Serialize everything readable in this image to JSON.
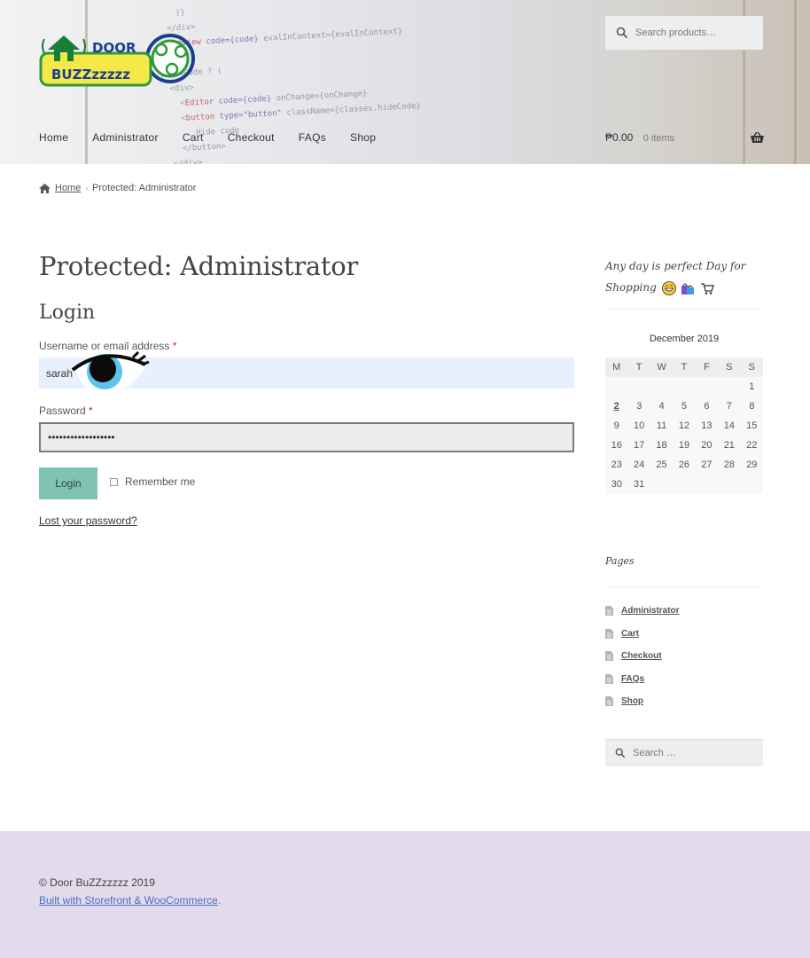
{
  "header": {
    "logo_text_top": "DOOR",
    "logo_text_bottom": "BUZZzzzzz",
    "search_placeholder": "Search products…",
    "nav": [
      "Home",
      "Administrator",
      "Cart",
      "Checkout",
      "FAQs",
      "Shop"
    ],
    "cart_amount": "₱0.00",
    "cart_count": "0 items"
  },
  "breadcrumb": {
    "home": "Home",
    "current": "Protected: Administrator"
  },
  "main": {
    "page_title": "Protected: Administrator",
    "login_heading": "Login",
    "username_label": "Username or email address",
    "username_value": "sarah",
    "password_label": "Password",
    "password_value": "••••••••••••••••••",
    "required_mark": "*",
    "login_button": "Login",
    "remember_label": "Remember me",
    "lost_password": "Lost your password?"
  },
  "sidebar": {
    "tagline": "Any day is perfect Day for Shopping",
    "calendar": {
      "caption": "December 2019",
      "weekdays": [
        "M",
        "T",
        "W",
        "T",
        "F",
        "S",
        "S"
      ],
      "weeks": [
        [
          "",
          "",
          "",
          "",
          "",
          "",
          "1"
        ],
        [
          "2",
          "3",
          "4",
          "5",
          "6",
          "7",
          "8"
        ],
        [
          "9",
          "10",
          "11",
          "12",
          "13",
          "14",
          "15"
        ],
        [
          "16",
          "17",
          "18",
          "19",
          "20",
          "21",
          "22"
        ],
        [
          "23",
          "24",
          "25",
          "26",
          "27",
          "28",
          "29"
        ],
        [
          "30",
          "31",
          "",
          "",
          "",
          "",
          ""
        ]
      ]
    },
    "pages_title": "Pages",
    "pages": [
      "Administrator",
      "Cart",
      "Checkout",
      "FAQs",
      "Shop"
    ],
    "search_placeholder": "Search …"
  },
  "footer": {
    "copyright": "© Door BuZZzzzzz 2019",
    "built_with": "Built with Storefront & WooCommerce",
    "built_with_suffix": "."
  },
  "colors": {
    "accent_button": "#7fc3b2",
    "footer_bg": "#e2dbec",
    "autofill_bg": "#e8f0fe",
    "link_blue": "#4a6fc2"
  }
}
